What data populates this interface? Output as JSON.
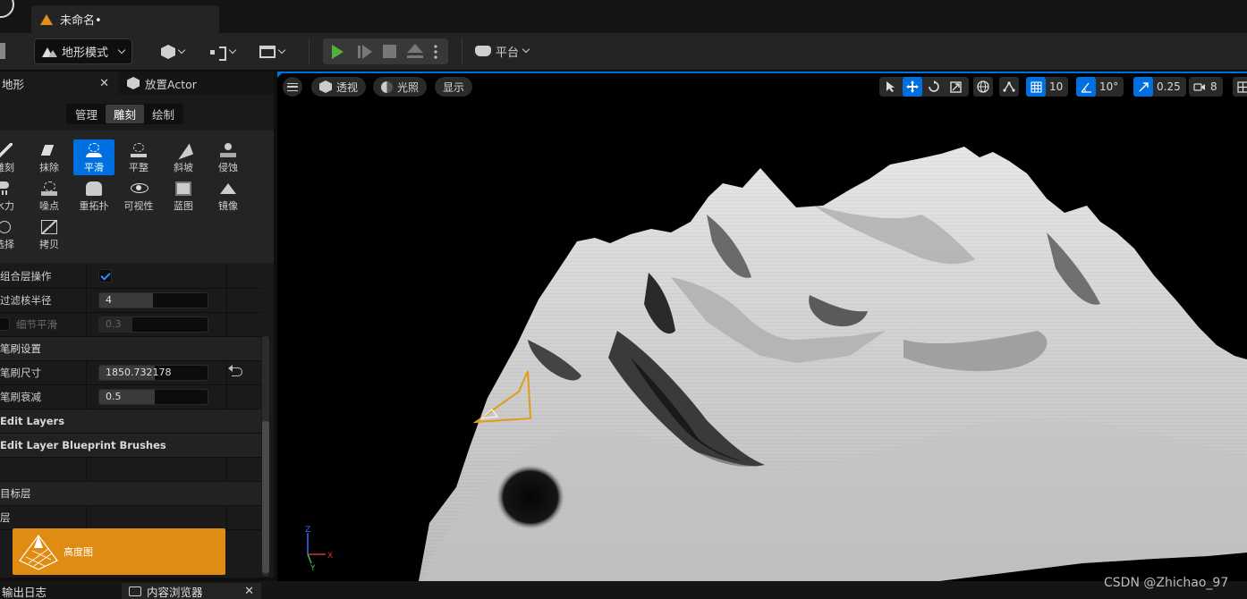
{
  "titlebar": {
    "doc_tab": "未命名•"
  },
  "toolbar": {
    "mode_label": "地形模式",
    "platform_label": "平台"
  },
  "left_panel": {
    "tab_label": "地形",
    "tab2_label": "放置Actor",
    "subtabs": [
      "管理",
      "雕刻",
      "绘制"
    ],
    "active_subtab": "雕刻",
    "tools": [
      "雕刻",
      "抹除",
      "平滑",
      "平整",
      "斜坡",
      "侵蚀",
      "水力",
      "噪点",
      "重拓扑",
      "可视性",
      "蓝图",
      "镜像",
      "选择",
      "拷贝"
    ],
    "active_tool": "平滑",
    "props": {
      "combine_layers_label": "组合层操作",
      "combine_layers_checked": true,
      "filter_radius_label": "过滤核半径",
      "filter_radius_value": "4",
      "detail_smooth_label": "细节平滑",
      "detail_smooth_value": "0.3",
      "brush_settings_label": "笔刷设置",
      "brush_size_label": "笔刷尺寸",
      "brush_size_value": "1850.732178",
      "brush_falloff_label": "笔刷衰减",
      "brush_falloff_value": "0.5",
      "edit_layers_label": "Edit Layers",
      "edit_layer_bp_label": "Edit Layer Blueprint Brushes",
      "target_layers_label": "目标层",
      "layers_label": "层",
      "heightmap_label": "高度图"
    }
  },
  "viewport": {
    "perspective_label": "透视",
    "lighting_label": "光照",
    "show_label": "显示",
    "grid_snap": "10",
    "rotation_snap": "10°",
    "scale_snap": "0.25",
    "camera_speed": "8",
    "gizmo_axes": [
      "Z",
      "X",
      "Y"
    ]
  },
  "bottom": {
    "output_log": "输出日志",
    "content_browser": "内容浏览器"
  },
  "watermark": "CSDN @Zhichao_97",
  "colors": {
    "accent": "#0070e0",
    "play_green": "#4fb33a",
    "layer_orange": "#e08c12"
  }
}
